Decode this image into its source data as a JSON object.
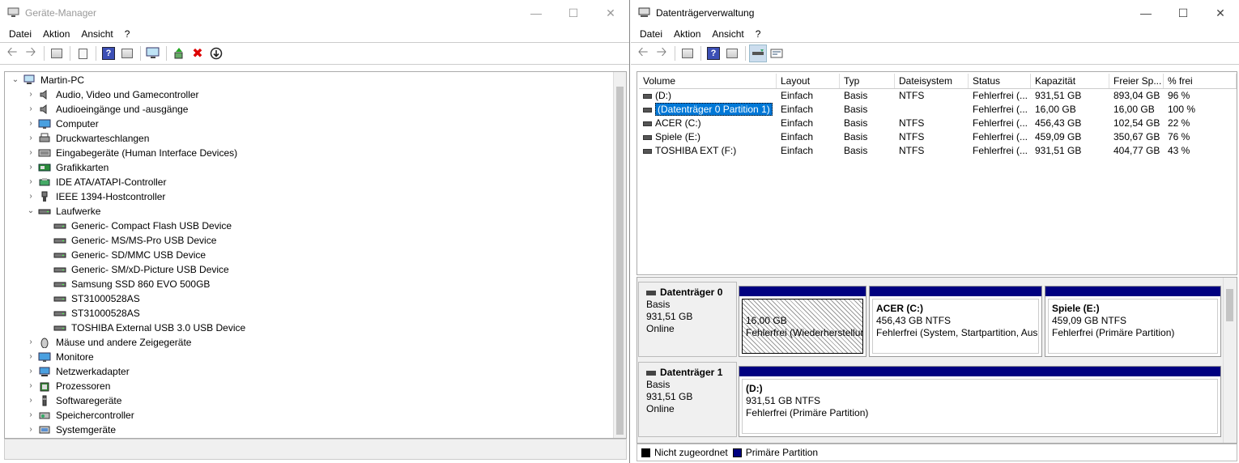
{
  "device_manager": {
    "title": "Geräte-Manager",
    "menu": [
      "Datei",
      "Aktion",
      "Ansicht",
      "?"
    ],
    "root": "Martin-PC",
    "categories": [
      {
        "label": "Audio, Video und Gamecontroller",
        "icon": "speaker-icon",
        "expanded": false
      },
      {
        "label": "Audioeingänge und -ausgänge",
        "icon": "speaker-icon",
        "expanded": false
      },
      {
        "label": "Computer",
        "icon": "monitor-icon",
        "expanded": false
      },
      {
        "label": "Druckwarteschlangen",
        "icon": "printer-icon",
        "expanded": false
      },
      {
        "label": "Eingabegeräte (Human Interface Devices)",
        "icon": "hid-icon",
        "expanded": false
      },
      {
        "label": "Grafikkarten",
        "icon": "display-adapter-icon",
        "expanded": false
      },
      {
        "label": "IDE ATA/ATAPI-Controller",
        "icon": "ide-controller-icon",
        "expanded": false
      },
      {
        "label": "IEEE 1394-Hostcontroller",
        "icon": "ieee1394-icon",
        "expanded": false
      },
      {
        "label": "Laufwerke",
        "icon": "drive-icon",
        "expanded": true,
        "children": [
          "Generic- Compact Flash USB Device",
          "Generic- MS/MS-Pro USB Device",
          "Generic- SD/MMC USB Device",
          "Generic- SM/xD-Picture USB Device",
          "Samsung SSD 860 EVO 500GB",
          "ST31000528AS",
          "ST31000528AS",
          "TOSHIBA External USB 3.0 USB Device"
        ]
      },
      {
        "label": "Mäuse und andere Zeigegeräte",
        "icon": "mouse-icon",
        "expanded": false
      },
      {
        "label": "Monitore",
        "icon": "monitor-icon",
        "expanded": false
      },
      {
        "label": "Netzwerkadapter",
        "icon": "network-icon",
        "expanded": false
      },
      {
        "label": "Prozessoren",
        "icon": "cpu-icon",
        "expanded": false
      },
      {
        "label": "Softwaregeräte",
        "icon": "software-device-icon",
        "expanded": false
      },
      {
        "label": "Speichercontroller",
        "icon": "storage-controller-icon",
        "expanded": false
      },
      {
        "label": "Systemgeräte",
        "icon": "system-device-icon",
        "expanded": false
      }
    ]
  },
  "disk_management": {
    "title": "Datenträgerverwaltung",
    "menu": [
      "Datei",
      "Aktion",
      "Ansicht",
      "?"
    ],
    "columns": [
      "Volume",
      "Layout",
      "Typ",
      "Dateisystem",
      "Status",
      "Kapazität",
      "Freier Sp...",
      "% frei"
    ],
    "volumes": [
      {
        "volume": "(D:)",
        "layout": "Einfach",
        "typ": "Basis",
        "fs": "NTFS",
        "status": "Fehlerfrei (...",
        "cap": "931,51 GB",
        "free": "893,04 GB",
        "pct": "96 %",
        "selected": false
      },
      {
        "volume": "(Datenträger 0 Partition 1)",
        "layout": "Einfach",
        "typ": "Basis",
        "fs": "",
        "status": "Fehlerfrei (...",
        "cap": "16,00 GB",
        "free": "16,00 GB",
        "pct": "100 %",
        "selected": true
      },
      {
        "volume": "ACER (C:)",
        "layout": "Einfach",
        "typ": "Basis",
        "fs": "NTFS",
        "status": "Fehlerfrei (...",
        "cap": "456,43 GB",
        "free": "102,54 GB",
        "pct": "22 %",
        "selected": false
      },
      {
        "volume": "Spiele (E:)",
        "layout": "Einfach",
        "typ": "Basis",
        "fs": "NTFS",
        "status": "Fehlerfrei (...",
        "cap": "459,09 GB",
        "free": "350,67 GB",
        "pct": "76 %",
        "selected": false
      },
      {
        "volume": "TOSHIBA EXT (F:)",
        "layout": "Einfach",
        "typ": "Basis",
        "fs": "NTFS",
        "status": "Fehlerfrei (...",
        "cap": "931,51 GB",
        "free": "404,77 GB",
        "pct": "43 %",
        "selected": false
      }
    ],
    "disks": [
      {
        "name": "Datenträger 0",
        "type": "Basis",
        "size": "931,51 GB",
        "state": "Online",
        "partitions": [
          {
            "title": "",
            "size": "16,00 GB",
            "status": "Fehlerfrei (Wiederherstellun",
            "hatched": true
          },
          {
            "title": "ACER  (C:)",
            "size": "456,43 GB NTFS",
            "status": "Fehlerfrei (System, Startpartition, Ausla",
            "hatched": false
          },
          {
            "title": "Spiele  (E:)",
            "size": "459,09 GB NTFS",
            "status": "Fehlerfrei (Primäre Partition)",
            "hatched": false
          }
        ]
      },
      {
        "name": "Datenträger 1",
        "type": "Basis",
        "size": "931,51 GB",
        "state": "Online",
        "partitions": [
          {
            "title": "(D:)",
            "size": "931,51 GB NTFS",
            "status": "Fehlerfrei (Primäre Partition)",
            "hatched": false
          }
        ]
      }
    ],
    "legend": [
      {
        "label": "Nicht zugeordnet",
        "color": "#000000"
      },
      {
        "label": "Primäre Partition",
        "color": "#000080"
      }
    ]
  }
}
